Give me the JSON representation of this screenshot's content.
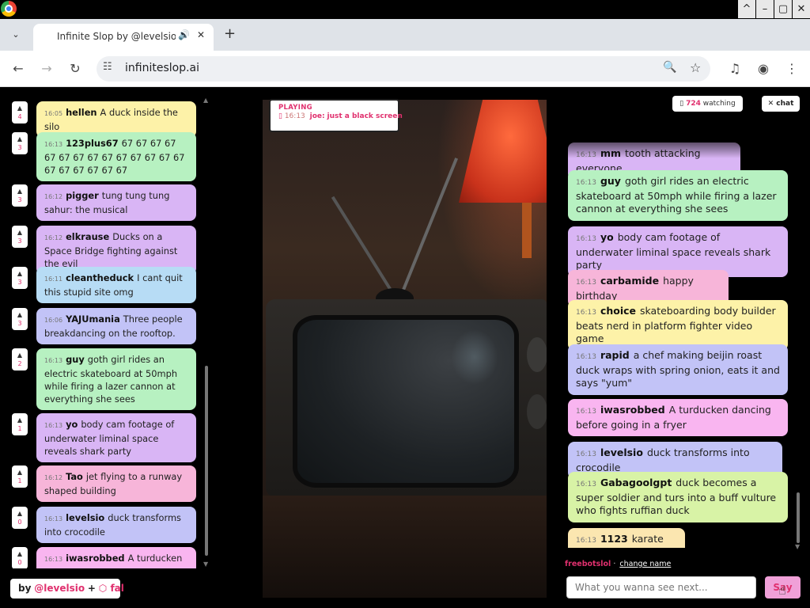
{
  "window_controls": {
    "restore": "^",
    "minimize": "–",
    "maximize": "▢",
    "close": "✕"
  },
  "browser": {
    "tab_dropdown": "⌄",
    "tab_title": "Infinite Slop by @levelsio",
    "tab_audio": "🔊",
    "tab_close": "✕",
    "new_tab": "+",
    "back": "←",
    "forward": "→",
    "reload": "↻",
    "site_info": "☷",
    "url": "infiniteslop.ai",
    "zoom": "🔍",
    "star": "☆",
    "media": "♫",
    "profile": "◉",
    "menu": "⋮"
  },
  "queue": {
    "up": "▲",
    "down": "▼",
    "items": [
      {
        "votes": "4",
        "time": "16:05",
        "user": "hellen",
        "text": "A duck inside the silo",
        "color": "#fdf2a8"
      },
      {
        "votes": "3",
        "time": "16:13",
        "user": "123plus67",
        "text": "67 67 67 67 67 67 67 67 67 67 67 67 67 67 67 67 67 67 67 67",
        "color": "#b7f1c1"
      },
      {
        "votes": "3",
        "time": "16:12",
        "user": "pigger",
        "text": "tung tung tung sahur: the musical",
        "color": "#d9b5f5"
      },
      {
        "votes": "3",
        "time": "16:12",
        "user": "elkrause",
        "text": "Ducks on a Space Bridge fighting against the evil",
        "color": "#d9b5f5"
      },
      {
        "votes": "3",
        "time": "16:11",
        "user": "cleantheduck",
        "text": "I cant quit this stupid site omg",
        "color": "#b7dcf5"
      },
      {
        "votes": "3",
        "time": "16:06",
        "user": "YAJUmania",
        "text": "Three people breakdancing on the rooftop.",
        "color": "#c2c3f7"
      },
      {
        "votes": "2",
        "time": "16:13",
        "user": "guy",
        "text": "goth girl rides an electric skateboard at 50mph while firing a lazer cannon at everything she sees",
        "color": "#b7f1c1"
      },
      {
        "votes": "1",
        "time": "16:13",
        "user": "yo",
        "text": "body cam footage of underwater liminal space reveals shark party",
        "color": "#d9b5f5"
      },
      {
        "votes": "1",
        "time": "16:12",
        "user": "Tao",
        "text": "jet flying to a runway shaped building",
        "color": "#f7b5d9"
      },
      {
        "votes": "0",
        "time": "16:13",
        "user": "levelsio",
        "text": "duck transforms into crocodile",
        "color": "#c2c3f7"
      },
      {
        "votes": "0",
        "time": "16:13",
        "user": "iwasrobbed",
        "text": "A turducken dancing before going in a fryer",
        "color": "#f9b5f0"
      }
    ]
  },
  "credit": {
    "by": "by",
    "author": "@levelsio",
    "plus": "+",
    "partner": "⬡ fal"
  },
  "playing": {
    "label": "PLAYING",
    "icon": "▯",
    "time": "16:13",
    "user": "joe:",
    "text": "just a black screen"
  },
  "watching": {
    "icon": "▯",
    "count": "724",
    "label": "watching"
  },
  "chat_toggle": "✕ chat",
  "chat": {
    "down": "▼",
    "messages": [
      {
        "time": "16:13",
        "user": "mm",
        "text": "tooth attacking everyone",
        "color": "#d9b5f5"
      },
      {
        "time": "16:13",
        "user": "guy",
        "text": "goth girl rides an electric skateboard at 50mph while firing a lazer cannon at everything she sees",
        "color": "#b7f1c1"
      },
      {
        "time": "16:13",
        "user": "yo",
        "text": "body cam footage of underwater liminal space reveals shark party",
        "color": "#d9b5f5"
      },
      {
        "time": "16:13",
        "user": "carbamide",
        "text": "happy birthday",
        "color": "#f7b5d9"
      },
      {
        "time": "16:13",
        "user": "choice",
        "text": "skateboarding body builder beats nerd in platform fighter video game",
        "color": "#fdf2a8"
      },
      {
        "time": "16:13",
        "user": "rapid",
        "text": "a chef making beijin roast duck wraps with spring onion, eats it and says \"yum\"",
        "color": "#c2c3f7"
      },
      {
        "time": "16:13",
        "user": "iwasrobbed",
        "text": "A turducken dancing before going in a fryer",
        "color": "#f9b5f0"
      },
      {
        "time": "16:13",
        "user": "levelsio",
        "text": "duck transforms into crocodile",
        "color": "#c2c3f7"
      },
      {
        "time": "16:13",
        "user": "Gabagoolgpt",
        "text": "duck becomes a super soldier and turs into a buff vulture who fights ruffian duck",
        "color": "#d8f3a6"
      },
      {
        "time": "16:13",
        "user": "1123",
        "text": "karate Goth",
        "color": "#fbe6b0"
      }
    ]
  },
  "me": {
    "name": "freebotslol",
    "sep": "·",
    "change_name": "change name"
  },
  "prompt": {
    "placeholder": "What you wanna see next...",
    "value": ""
  },
  "say_label": "Say",
  "cursor": "☝"
}
